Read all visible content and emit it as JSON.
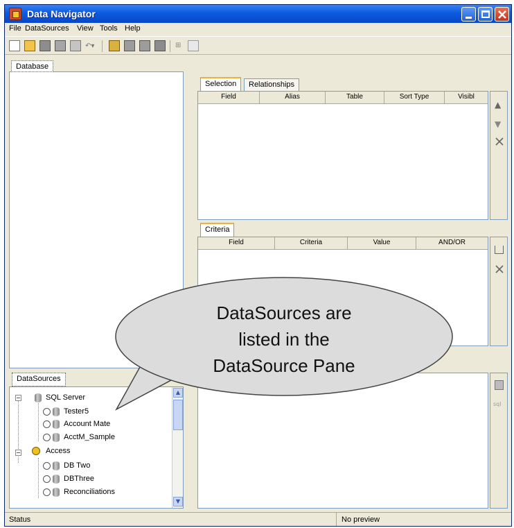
{
  "window": {
    "title": "Data Navigator"
  },
  "menu": [
    "File",
    "DataSources",
    "View",
    "Tools",
    "Help"
  ],
  "left_pane": {
    "tab_label": "Database"
  },
  "selection_panel": {
    "tabs": [
      "Selection",
      "Relationships"
    ],
    "columns": [
      "Field",
      "Alias",
      "Table",
      "Sort Type",
      "Visibl"
    ]
  },
  "criteria_panel": {
    "tab_label": "Criteria",
    "columns": [
      "Field",
      "Criteria",
      "Value",
      "AND/OR"
    ]
  },
  "datasources_pane": {
    "tab_label": "DataSources",
    "tree": [
      {
        "label": "SQL Server",
        "children": [
          "Tester5",
          "Account Mate",
          "AcctM_Sample"
        ]
      },
      {
        "label": "Access",
        "children": [
          "DB Two",
          "DBThree",
          "Reconciliations"
        ]
      }
    ]
  },
  "callout": {
    "line1": "DataSources are",
    "line2": "listed in the",
    "line3": "DataSource Pane"
  },
  "status": {
    "left": "Status",
    "right": "No preview"
  }
}
